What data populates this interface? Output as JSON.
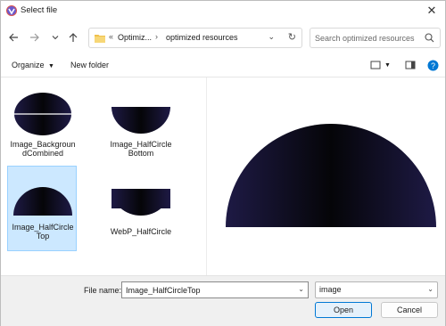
{
  "window": {
    "title": "Select file"
  },
  "nav": {
    "breadcrumb": [
      "Optimiz...",
      "optimized resources"
    ],
    "search_placeholder": "Search optimized resources"
  },
  "toolbar": {
    "organize_label": "Organize",
    "new_folder_label": "New folder"
  },
  "files": [
    {
      "name": "Image_BackgroundCombined",
      "thumb": "combined"
    },
    {
      "name": "Image_HalfCircleBottom",
      "thumb": "bottom"
    },
    {
      "name": "Image_HalfCircleTop",
      "thumb": "top",
      "selected": true
    },
    {
      "name": "WebP_HalfCircle",
      "thumb": "webp"
    }
  ],
  "footer": {
    "file_name_label": "File name:",
    "file_name_value": "Image_HalfCircleTop",
    "file_type_value": "image",
    "open_label": "Open",
    "cancel_label": "Cancel"
  },
  "colors": {
    "accent": "#0078d4",
    "selection": "#cce8ff",
    "shape_dark": "#0c0a1e",
    "shape_edge": "#1e1a45"
  }
}
